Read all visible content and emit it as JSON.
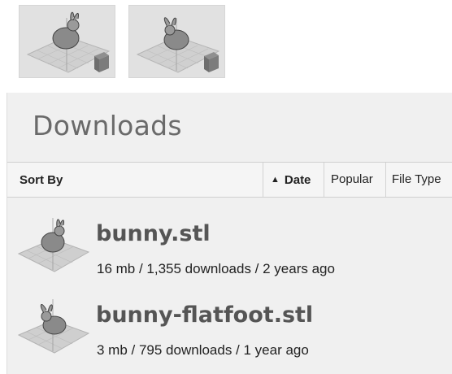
{
  "thumbnails": [
    {
      "icon": "bunny-model-thumbnail-icon"
    },
    {
      "icon": "bunny-flatfoot-model-thumbnail-icon"
    }
  ],
  "downloads": {
    "title": "Downloads",
    "sort_by_label": "Sort By",
    "sort_options": [
      {
        "label": "Date",
        "active": true,
        "icon": "sort-ascending-arrow-icon",
        "arrow": "▲"
      },
      {
        "label": "Popular",
        "active": false
      },
      {
        "label": "File Type",
        "active": false
      }
    ],
    "files": [
      {
        "name": "bunny.stl",
        "meta": "16 mb / 1,355 downloads / 2 years ago",
        "icon": "bunny-model-thumbnail-icon"
      },
      {
        "name": "bunny-flatfoot.stl",
        "meta": "3 mb / 795 downloads / 1 year ago",
        "icon": "bunny-flatfoot-model-thumbnail-icon"
      }
    ]
  }
}
